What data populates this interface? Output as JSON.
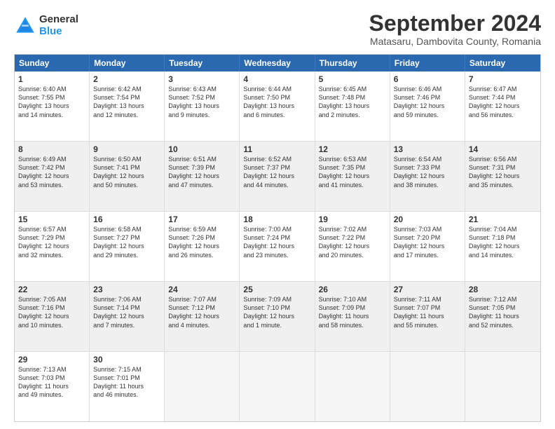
{
  "logo": {
    "general": "General",
    "blue": "Blue"
  },
  "title": "September 2024",
  "subtitle": "Matasaru, Dambovita County, Romania",
  "header_days": [
    "Sunday",
    "Monday",
    "Tuesday",
    "Wednesday",
    "Thursday",
    "Friday",
    "Saturday"
  ],
  "weeks": [
    [
      {
        "day": "1",
        "lines": [
          "Sunrise: 6:40 AM",
          "Sunset: 7:55 PM",
          "Daylight: 13 hours",
          "and 14 minutes."
        ],
        "shaded": false
      },
      {
        "day": "2",
        "lines": [
          "Sunrise: 6:42 AM",
          "Sunset: 7:54 PM",
          "Daylight: 13 hours",
          "and 12 minutes."
        ],
        "shaded": false
      },
      {
        "day": "3",
        "lines": [
          "Sunrise: 6:43 AM",
          "Sunset: 7:52 PM",
          "Daylight: 13 hours",
          "and 9 minutes."
        ],
        "shaded": false
      },
      {
        "day": "4",
        "lines": [
          "Sunrise: 6:44 AM",
          "Sunset: 7:50 PM",
          "Daylight: 13 hours",
          "and 6 minutes."
        ],
        "shaded": false
      },
      {
        "day": "5",
        "lines": [
          "Sunrise: 6:45 AM",
          "Sunset: 7:48 PM",
          "Daylight: 13 hours",
          "and 2 minutes."
        ],
        "shaded": false
      },
      {
        "day": "6",
        "lines": [
          "Sunrise: 6:46 AM",
          "Sunset: 7:46 PM",
          "Daylight: 12 hours",
          "and 59 minutes."
        ],
        "shaded": false
      },
      {
        "day": "7",
        "lines": [
          "Sunrise: 6:47 AM",
          "Sunset: 7:44 PM",
          "Daylight: 12 hours",
          "and 56 minutes."
        ],
        "shaded": false
      }
    ],
    [
      {
        "day": "8",
        "lines": [
          "Sunrise: 6:49 AM",
          "Sunset: 7:42 PM",
          "Daylight: 12 hours",
          "and 53 minutes."
        ],
        "shaded": true
      },
      {
        "day": "9",
        "lines": [
          "Sunrise: 6:50 AM",
          "Sunset: 7:41 PM",
          "Daylight: 12 hours",
          "and 50 minutes."
        ],
        "shaded": true
      },
      {
        "day": "10",
        "lines": [
          "Sunrise: 6:51 AM",
          "Sunset: 7:39 PM",
          "Daylight: 12 hours",
          "and 47 minutes."
        ],
        "shaded": true
      },
      {
        "day": "11",
        "lines": [
          "Sunrise: 6:52 AM",
          "Sunset: 7:37 PM",
          "Daylight: 12 hours",
          "and 44 minutes."
        ],
        "shaded": true
      },
      {
        "day": "12",
        "lines": [
          "Sunrise: 6:53 AM",
          "Sunset: 7:35 PM",
          "Daylight: 12 hours",
          "and 41 minutes."
        ],
        "shaded": true
      },
      {
        "day": "13",
        "lines": [
          "Sunrise: 6:54 AM",
          "Sunset: 7:33 PM",
          "Daylight: 12 hours",
          "and 38 minutes."
        ],
        "shaded": true
      },
      {
        "day": "14",
        "lines": [
          "Sunrise: 6:56 AM",
          "Sunset: 7:31 PM",
          "Daylight: 12 hours",
          "and 35 minutes."
        ],
        "shaded": true
      }
    ],
    [
      {
        "day": "15",
        "lines": [
          "Sunrise: 6:57 AM",
          "Sunset: 7:29 PM",
          "Daylight: 12 hours",
          "and 32 minutes."
        ],
        "shaded": false
      },
      {
        "day": "16",
        "lines": [
          "Sunrise: 6:58 AM",
          "Sunset: 7:27 PM",
          "Daylight: 12 hours",
          "and 29 minutes."
        ],
        "shaded": false
      },
      {
        "day": "17",
        "lines": [
          "Sunrise: 6:59 AM",
          "Sunset: 7:26 PM",
          "Daylight: 12 hours",
          "and 26 minutes."
        ],
        "shaded": false
      },
      {
        "day": "18",
        "lines": [
          "Sunrise: 7:00 AM",
          "Sunset: 7:24 PM",
          "Daylight: 12 hours",
          "and 23 minutes."
        ],
        "shaded": false
      },
      {
        "day": "19",
        "lines": [
          "Sunrise: 7:02 AM",
          "Sunset: 7:22 PM",
          "Daylight: 12 hours",
          "and 20 minutes."
        ],
        "shaded": false
      },
      {
        "day": "20",
        "lines": [
          "Sunrise: 7:03 AM",
          "Sunset: 7:20 PM",
          "Daylight: 12 hours",
          "and 17 minutes."
        ],
        "shaded": false
      },
      {
        "day": "21",
        "lines": [
          "Sunrise: 7:04 AM",
          "Sunset: 7:18 PM",
          "Daylight: 12 hours",
          "and 14 minutes."
        ],
        "shaded": false
      }
    ],
    [
      {
        "day": "22",
        "lines": [
          "Sunrise: 7:05 AM",
          "Sunset: 7:16 PM",
          "Daylight: 12 hours",
          "and 10 minutes."
        ],
        "shaded": true
      },
      {
        "day": "23",
        "lines": [
          "Sunrise: 7:06 AM",
          "Sunset: 7:14 PM",
          "Daylight: 12 hours",
          "and 7 minutes."
        ],
        "shaded": true
      },
      {
        "day": "24",
        "lines": [
          "Sunrise: 7:07 AM",
          "Sunset: 7:12 PM",
          "Daylight: 12 hours",
          "and 4 minutes."
        ],
        "shaded": true
      },
      {
        "day": "25",
        "lines": [
          "Sunrise: 7:09 AM",
          "Sunset: 7:10 PM",
          "Daylight: 12 hours",
          "and 1 minute."
        ],
        "shaded": true
      },
      {
        "day": "26",
        "lines": [
          "Sunrise: 7:10 AM",
          "Sunset: 7:09 PM",
          "Daylight: 11 hours",
          "and 58 minutes."
        ],
        "shaded": true
      },
      {
        "day": "27",
        "lines": [
          "Sunrise: 7:11 AM",
          "Sunset: 7:07 PM",
          "Daylight: 11 hours",
          "and 55 minutes."
        ],
        "shaded": true
      },
      {
        "day": "28",
        "lines": [
          "Sunrise: 7:12 AM",
          "Sunset: 7:05 PM",
          "Daylight: 11 hours",
          "and 52 minutes."
        ],
        "shaded": true
      }
    ],
    [
      {
        "day": "29",
        "lines": [
          "Sunrise: 7:13 AM",
          "Sunset: 7:03 PM",
          "Daylight: 11 hours",
          "and 49 minutes."
        ],
        "shaded": false
      },
      {
        "day": "30",
        "lines": [
          "Sunrise: 7:15 AM",
          "Sunset: 7:01 PM",
          "Daylight: 11 hours",
          "and 46 minutes."
        ],
        "shaded": false
      },
      {
        "day": "",
        "lines": [],
        "shaded": false,
        "empty": true
      },
      {
        "day": "",
        "lines": [],
        "shaded": false,
        "empty": true
      },
      {
        "day": "",
        "lines": [],
        "shaded": false,
        "empty": true
      },
      {
        "day": "",
        "lines": [],
        "shaded": false,
        "empty": true
      },
      {
        "day": "",
        "lines": [],
        "shaded": false,
        "empty": true
      }
    ]
  ]
}
